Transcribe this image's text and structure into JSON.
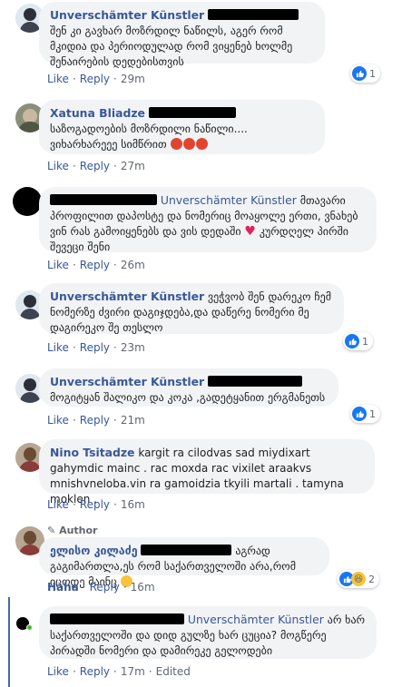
{
  "comments": [
    {
      "name": "Unverschämter Künstler",
      "text": "შენ კი გავხარ მოზრდილ ნაწილს, აგერ რომ მკიდია და პერიოდულად რომ ვიყენებ ხოლმე შენაირების დედებისთვის",
      "like": "Like",
      "reply": "Reply",
      "time": "29m",
      "reactions": "1"
    },
    {
      "name": "Xatuna Bliadze",
      "text": "საზოგადოების მოზრდილი ნაწილი....",
      "text2": "ვიხარხარეეე სიმწრით",
      "like": "Like",
      "reply": "Reply",
      "time": "27m"
    },
    {
      "name": "Unverschämter Künstler",
      "text": "მთავარი პროფილით დაპოსტე და ნომერიც მოაყოლე ერთი, ვნახებ ვინ რას გამოიყენებს და ვის დედაში",
      "text2": "კურდღელ პირში შევეცი შენი",
      "like": "Like",
      "reply": "Reply",
      "time": "26m"
    },
    {
      "name": "Unverschämter Künstler",
      "text": "ვეჭვობ შენ დარეკო ჩემ ნომერზე ძვირი დაგიჯდება,და დაწერე ნომერი მე დაგირეკო შე თესლო",
      "like": "Like",
      "reply": "Reply",
      "time": "23m",
      "reactions": "1"
    },
    {
      "name": "Unverschämter Künstler",
      "text": "მოგიტყან შალიკო და კოკა ,გადეტყანით ერგმანეთს",
      "like": "Like",
      "reply": "Reply",
      "time": "21m",
      "reactions": "1"
    },
    {
      "name": "Nino Tsitadze",
      "text": "kargit ra cilodvas sad miydixart gahymdic mainc . rac moxda rac vixilet araakvs mnishvneloba.vin ra gamoidzia tkyili martali . tamyna moklen .",
      "like": "Like",
      "reply": "Reply",
      "time": "16m"
    },
    {
      "author_badge": "Author",
      "name": "ელისო კილაძე",
      "text": "აგრად გაგიმართლა,ეს რომ საქართველოში არა,რომ იცოდე მაინც",
      "like": "Haha",
      "reply": "Reply",
      "time": "16m",
      "reactions": "2"
    },
    {
      "name": "Unverschämter Künstler",
      "text": "არ ხარ საქართველოში და დიდ გულზე ხარ ცუცია? მოგწერე პირადში ნომერი და დამირეკე გელოდები",
      "like": "Like",
      "reply": "Reply",
      "time": "17m",
      "edited": "Edited"
    }
  ],
  "colors": {
    "name": "#385898",
    "bubble": "#f2f3f5",
    "like": "#1877f2",
    "haha": "#e5a514"
  }
}
